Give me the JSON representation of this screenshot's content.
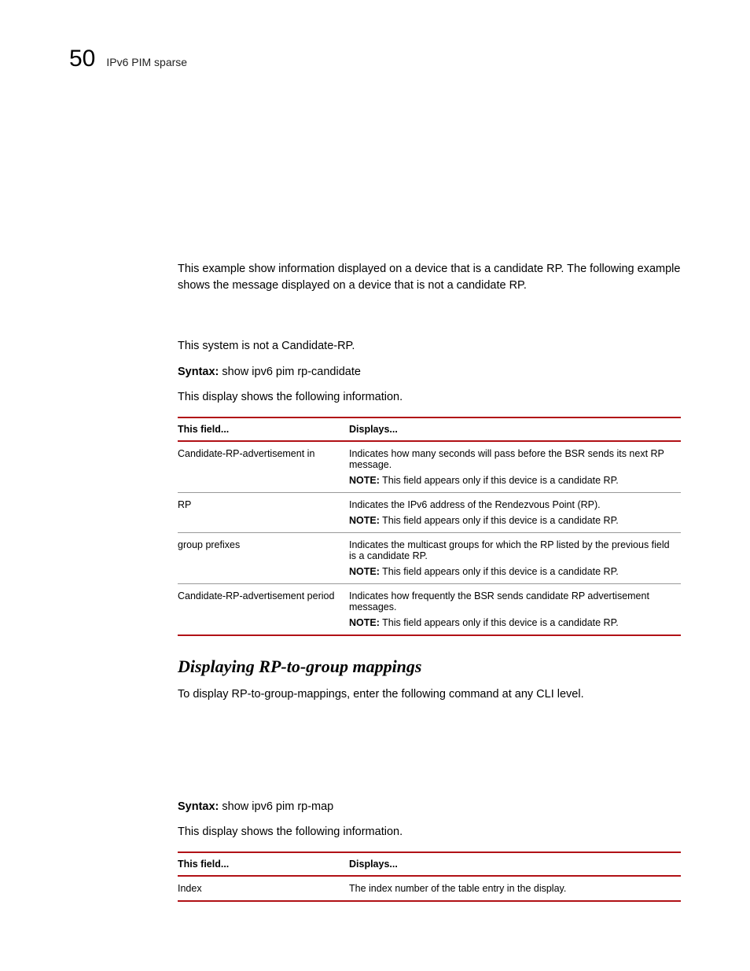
{
  "header": {
    "page_number": "50",
    "running_title": "IPv6 PIM sparse"
  },
  "intro_para": "This example show information displayed on a device that is a candidate RP.  The following example shows the message displayed on a device that is not a candidate RP.",
  "not_candidate_line": "This system is not a Candidate-RP.",
  "syntax1_label": "Syntax:",
  "syntax1_cmd": " show ipv6 pim  rp-candidate",
  "display_intro1": "This display shows the following information.",
  "table1": {
    "head_a": "This field...",
    "head_b": "Displays...",
    "rows": [
      {
        "field": "Candidate-RP-advertisement in",
        "desc": "Indicates how many seconds will pass before the BSR sends its next RP message.",
        "note_label": "NOTE:",
        "note": "  This field appears only if this device is a candidate RP."
      },
      {
        "field": "RP",
        "desc": "Indicates the IPv6  address of the Rendezvous Point (RP).",
        "note_label": "NOTE:",
        "note": "  This field appears only if this device is a candidate RP."
      },
      {
        "field": "group prefixes",
        "desc": "Indicates the multicast groups for which the RP listed by the previous field is a candidate RP.",
        "note_label": "NOTE:",
        "note": "  This field appears only if this device is a candidate RP."
      },
      {
        "field": "Candidate-RP-advertisement period",
        "desc": "Indicates how frequently the BSR sends candidate RP advertisement messages.",
        "note_label": "NOTE:",
        "note": "  This field appears only if this device is a candidate RP."
      }
    ]
  },
  "section_heading": "Displaying RP-to-group mappings",
  "section_para": "To display RP-to-group-mappings, enter the following command at any CLI level.",
  "syntax2_label": "Syntax:",
  "syntax2_cmd": " show ipv6 pim  rp-map",
  "display_intro2": "This display shows the following information.",
  "table2": {
    "head_a": "This field...",
    "head_b": "Displays...",
    "rows": [
      {
        "field": "Index",
        "desc": "The index number of the table entry in the display."
      }
    ]
  }
}
